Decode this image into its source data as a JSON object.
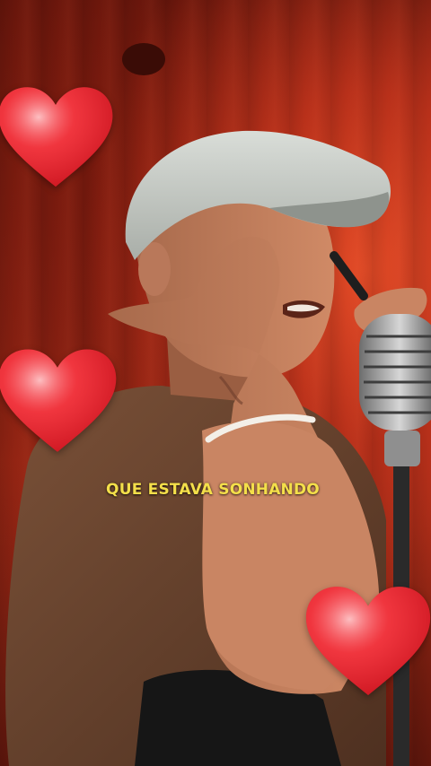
{
  "video": {
    "caption": "QUE ESTAVA SONHANDO",
    "caption_color": "#f4df4a"
  },
  "overlays": {
    "hearts": [
      "heart-icon",
      "heart-icon",
      "heart-icon"
    ],
    "heart_color": "#e8222c"
  },
  "scene": {
    "subject": "singer-with-microphone",
    "background_color": "#a22a16"
  }
}
